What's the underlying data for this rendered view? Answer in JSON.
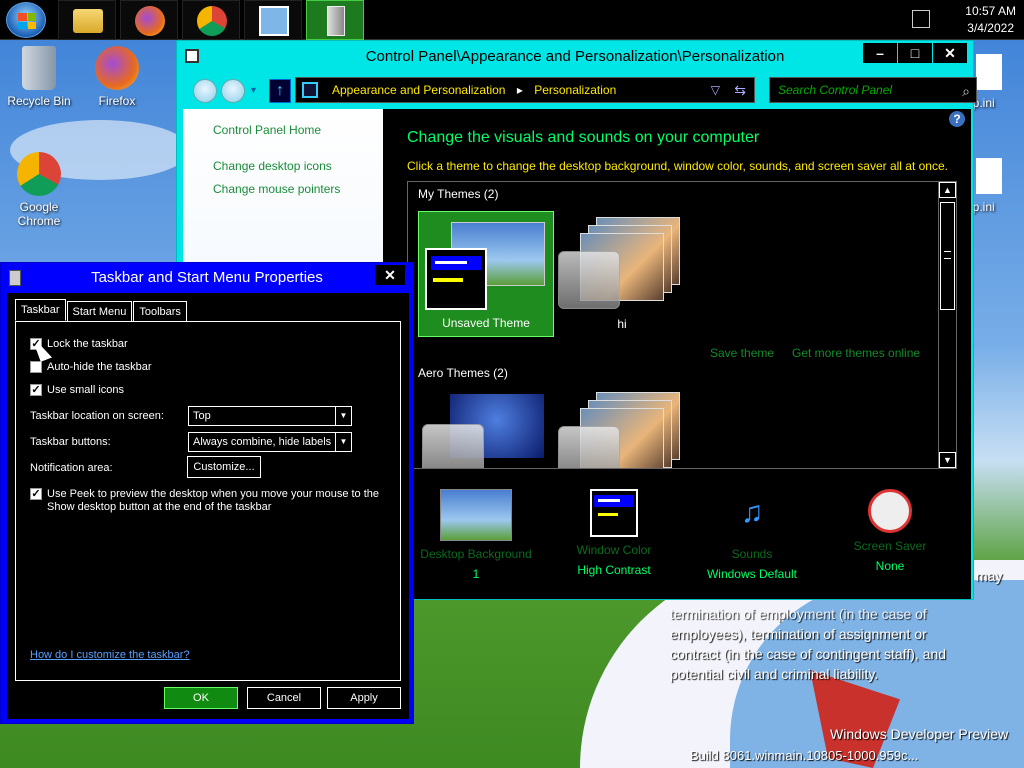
{
  "taskbar": {
    "clock_time": "10:57 AM",
    "clock_date": "3/4/2022",
    "pinned": [
      "start-orb",
      "file-explorer",
      "firefox",
      "chrome",
      "control-panel",
      "server-manager"
    ]
  },
  "desktop": {
    "icons": [
      {
        "label": "Recycle Bin"
      },
      {
        "label": "Firefox"
      },
      {
        "label": "Google Chrome"
      },
      {
        "label": "op.ini"
      },
      {
        "label": "op.ini"
      }
    ],
    "bg_text": {
      "line0": "may",
      "line1": "termination of employment (in the case of",
      "line2": "employees), termination of assignment or",
      "line3": "contract (in the case of contingent staff), and",
      "line4": "potential civil and criminal liability.",
      "line5": "Windows Developer Preview",
      "line6": "Build 8061.winmain.10805-1000.959c..."
    }
  },
  "control_panel": {
    "title": "Control Panel\\Appearance and Personalization\\Personalization",
    "breadcrumb": [
      "Appearance and Personalization",
      "Personalization"
    ],
    "search_placeholder": "Search Control Panel",
    "side_links": {
      "home": "Control Panel Home",
      "desktop_icons": "Change desktop icons",
      "mouse_pointers": "Change mouse pointers"
    },
    "heading": "Change the visuals and sounds on your computer",
    "subheading": "Click a theme to change the desktop background, window color, sounds, and screen saver all at once.",
    "my_themes_label": "My Themes (2)",
    "aero_themes_label": "Aero Themes (2)",
    "themes": {
      "unsaved": "Unsaved Theme",
      "hi": "hi"
    },
    "save_theme": "Save theme",
    "get_more": "Get more themes online",
    "bottom": {
      "background": {
        "label": "Desktop Background",
        "value": "1"
      },
      "color": {
        "label": "Window Color",
        "value": "High Contrast"
      },
      "sounds": {
        "label": "Sounds",
        "value": "Windows Default"
      },
      "saver": {
        "label": "Screen Saver",
        "value": "None"
      }
    }
  },
  "dialog": {
    "title": "Taskbar and Start Menu Properties",
    "tabs": [
      "Taskbar",
      "Start Menu",
      "Toolbars"
    ],
    "checkboxes": {
      "lock": {
        "label": "Lock the taskbar",
        "checked": true
      },
      "autohide": {
        "label": "Auto-hide the taskbar",
        "checked": false
      },
      "small_icons": {
        "label": "Use small icons",
        "checked": true
      },
      "peek": {
        "label": "Use Peek to preview the desktop when you move your mouse to the Show desktop button at the end of the taskbar",
        "checked": true
      }
    },
    "location_label": "Taskbar location on screen:",
    "location_value": "Top",
    "buttons_label": "Taskbar buttons:",
    "buttons_value": "Always combine, hide labels",
    "notification_label": "Notification area:",
    "customize_button": "Customize...",
    "help_link": "How do I customize the taskbar?",
    "ok": "OK",
    "cancel": "Cancel",
    "apply": "Apply"
  },
  "colors": {
    "accent_cyan": "#00e5e5",
    "dialog_blue": "#0000ff",
    "hc_green": "#00ff66",
    "hc_yellow": "#ffea00"
  }
}
